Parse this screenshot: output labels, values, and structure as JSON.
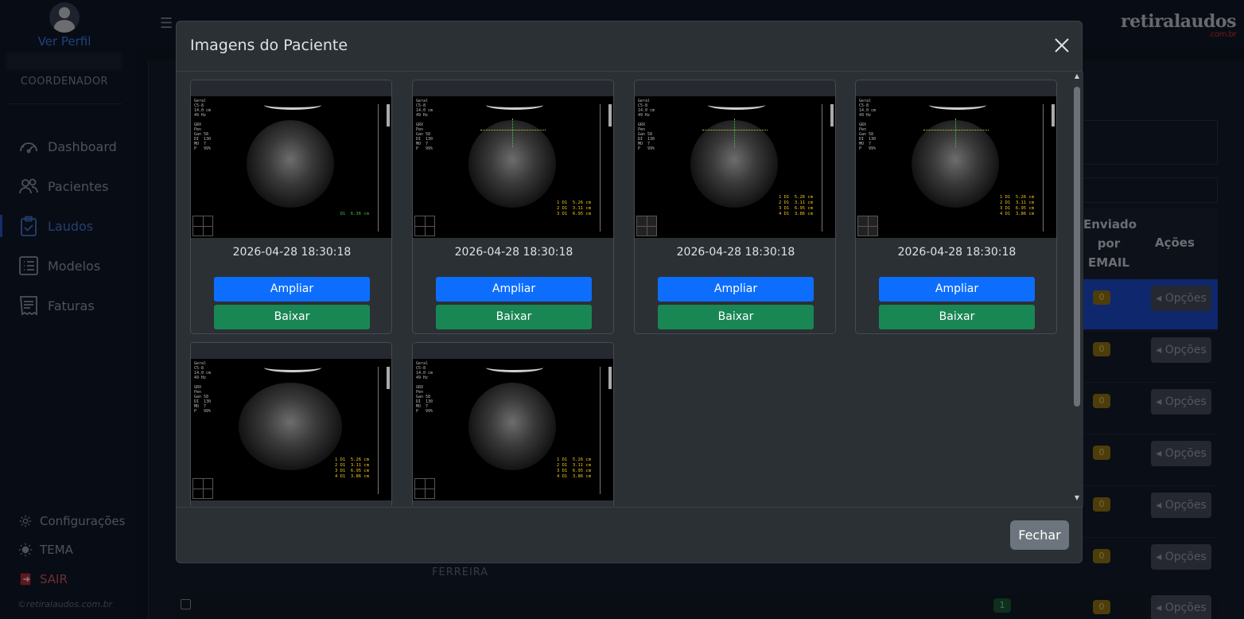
{
  "sidebar": {
    "profile_link": "Ver Perfil",
    "role": "COORDENADOR",
    "nav": [
      {
        "label": "Dashboard",
        "icon": "dashboard-icon"
      },
      {
        "label": "Pacientes",
        "icon": "users-icon"
      },
      {
        "label": "Laudos",
        "icon": "clipboard-check-icon",
        "active": true
      },
      {
        "label": "Modelos",
        "icon": "list-icon"
      },
      {
        "label": "Faturas",
        "icon": "receipt-icon"
      }
    ],
    "configuracoes": "Configurações",
    "tema": "TEMA",
    "sair": "SAIR",
    "copyright": "©retiralaudos.com.br"
  },
  "topbar": {
    "logo": "retiralaudos",
    "logo_suffix": ".com.br"
  },
  "background_table": {
    "col_email": "Enviado por EMAIL",
    "col_acoes": "Ações",
    "rows": [
      {
        "email_count": "0",
        "action": "Opções"
      },
      {
        "email_count": "0",
        "action": "Opções"
      },
      {
        "email_count": "0",
        "action": "Opções"
      },
      {
        "email_count": "0",
        "action": "Opções"
      },
      {
        "email_count": "0",
        "action": "Opções"
      },
      {
        "email_count": "0",
        "action": "Opções"
      },
      {
        "email_count": "0",
        "action": "Opções"
      }
    ],
    "partial_name": "FERREIRA",
    "last_row_badge": "1"
  },
  "modal": {
    "title": "Imagens do Paciente",
    "close_button": "Fechar",
    "images": [
      {
        "date": "2026-04-28 18:30:18",
        "zoom_label": "Ampliar",
        "download_label": "Baixar"
      },
      {
        "date": "2026-04-28 18:30:18",
        "zoom_label": "Ampliar",
        "download_label": "Baixar"
      },
      {
        "date": "2026-04-28 18:30:18",
        "zoom_label": "Ampliar",
        "download_label": "Baixar"
      },
      {
        "date": "2026-04-28 18:30:18",
        "zoom_label": "Ampliar",
        "download_label": "Baixar"
      },
      {
        "date": "",
        "zoom_label": "",
        "download_label": ""
      },
      {
        "date": "",
        "zoom_label": "",
        "download_label": ""
      }
    ]
  },
  "colors": {
    "ampliar": "#0d6efd",
    "baixar": "#198754",
    "fechar": "#6c757d",
    "accent": "#3b82f6"
  }
}
